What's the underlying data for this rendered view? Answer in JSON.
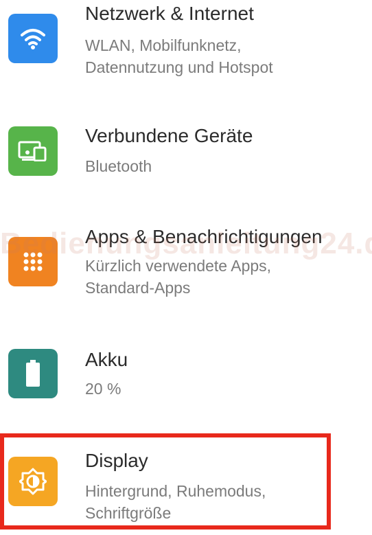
{
  "settings": {
    "items": [
      {
        "id": "network",
        "icon": "wifi-icon",
        "color": "#2F8BEB",
        "title": "Netzwerk & Internet",
        "subtitle_line1": "WLAN, Mobilfunknetz,",
        "subtitle_line2": "Datennutzung und Hotspot"
      },
      {
        "id": "connected-devices",
        "icon": "devices-icon",
        "color": "#57B44A",
        "title": "Verbundene Geräte",
        "subtitle_line1": "Bluetooth",
        "subtitle_line2": ""
      },
      {
        "id": "apps",
        "icon": "apps-grid-icon",
        "color": "#F08321",
        "title": "Apps & Benachrichtigungen",
        "subtitle_line1": "Kürzlich verwendete Apps,",
        "subtitle_line2": "Standard-Apps"
      },
      {
        "id": "battery",
        "icon": "battery-icon",
        "color": "#2E8A80",
        "title": "Akku",
        "subtitle_line1": "20 %",
        "subtitle_line2": ""
      },
      {
        "id": "display",
        "icon": "brightness-icon",
        "color": "#F5A623",
        "title": "Display",
        "subtitle_line1": "Hintergrund, Ruhemodus,",
        "subtitle_line2": "Schriftgröße"
      }
    ]
  },
  "watermark": "Bedienungsanleitung24.de",
  "highlight_color": "#E8291C"
}
